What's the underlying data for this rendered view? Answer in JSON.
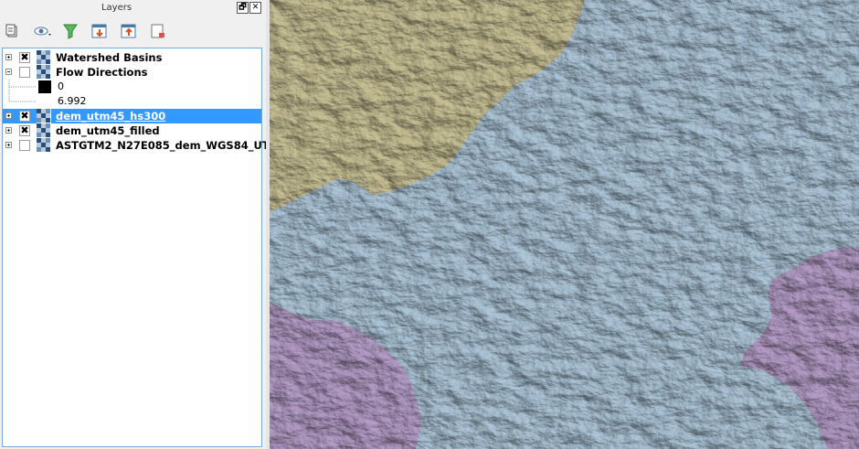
{
  "panel": {
    "title": "Layers",
    "float_button": "🗗",
    "close_button": "✕"
  },
  "toolbar": {
    "tools": [
      {
        "name": "add-group-icon"
      },
      {
        "name": "visibility-icon"
      },
      {
        "name": "filter-icon"
      },
      {
        "name": "expand-all-icon"
      },
      {
        "name": "collapse-all-icon"
      },
      {
        "name": "remove-layer-icon"
      }
    ]
  },
  "layers": [
    {
      "label": "Watershed Basins",
      "checked": true,
      "expander": "plus",
      "selected": false
    },
    {
      "label": "Flow Directions",
      "checked": false,
      "expander": "minus",
      "selected": false
    },
    {
      "label": "dem_utm45_hs300",
      "checked": true,
      "expander": "plus",
      "selected": true
    },
    {
      "label": "dem_utm45_filled",
      "checked": true,
      "expander": "plus",
      "selected": false
    },
    {
      "label": "ASTGTM2_N27E085_dem_WGS84_UT...",
      "checked": false,
      "expander": "plus",
      "selected": false
    }
  ],
  "flow_legend": {
    "min": "0",
    "max": "6.992"
  },
  "map": {
    "colors": {
      "blue_basin": "#b3cde0",
      "yellow_basin": "#cfc79a",
      "purple_basin": "#bca3cf"
    }
  }
}
